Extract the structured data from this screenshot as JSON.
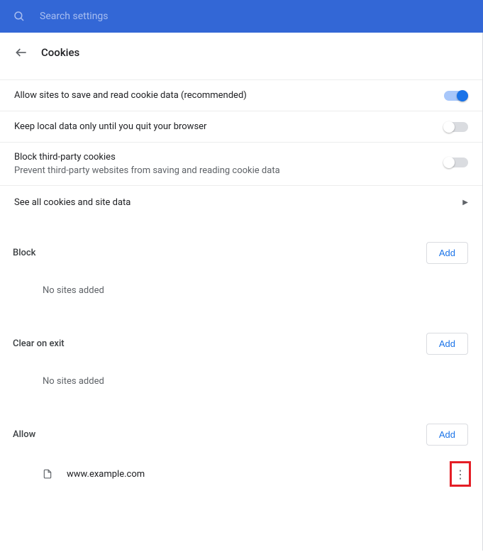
{
  "search": {
    "placeholder": "Search settings"
  },
  "header": {
    "title": "Cookies"
  },
  "settings": {
    "allow_cookies": {
      "label": "Allow sites to save and read cookie data (recommended)",
      "on": true
    },
    "keep_until_quit": {
      "label": "Keep local data only until you quit your browser",
      "on": false
    },
    "block_third": {
      "label": "Block third-party cookies",
      "sub": "Prevent third-party websites from saving and reading cookie data",
      "on": false
    },
    "see_all": {
      "label": "See all cookies and site data"
    }
  },
  "sections": {
    "block": {
      "title": "Block",
      "add": "Add",
      "empty": "No sites added"
    },
    "clear_on_exit": {
      "title": "Clear on exit",
      "add": "Add",
      "empty": "No sites added"
    },
    "allow": {
      "title": "Allow",
      "add": "Add",
      "sites": [
        {
          "name": "www.example.com"
        }
      ]
    }
  }
}
